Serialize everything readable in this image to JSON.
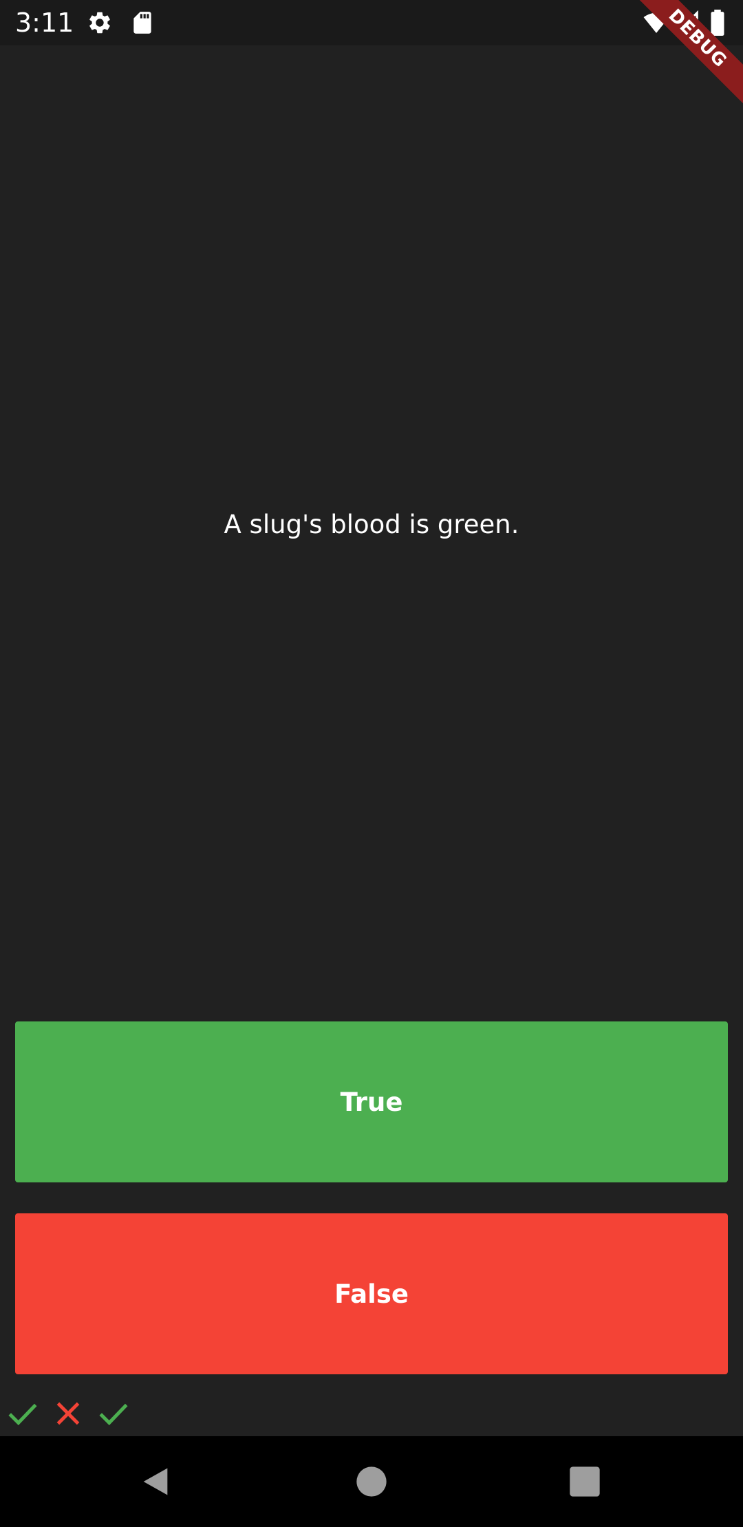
{
  "status_bar": {
    "time": "3:11",
    "icons": [
      "gear-icon",
      "sd-card-icon",
      "wifi-icon",
      "cell-signal-icon",
      "battery-icon"
    ]
  },
  "debug_banner": {
    "label": "DEBUG",
    "color": "#8b1d1d"
  },
  "question": {
    "text": "A slug's blood is green."
  },
  "buttons": {
    "true_label": "True",
    "true_color": "#4caf50",
    "false_label": "False",
    "false_color": "#f44336"
  },
  "score": {
    "results": [
      {
        "icon": "check-icon",
        "correct": true,
        "color": "#4caf50"
      },
      {
        "icon": "close-icon",
        "correct": false,
        "color": "#f44336"
      },
      {
        "icon": "check-icon",
        "correct": true,
        "color": "#4caf50"
      }
    ]
  },
  "nav": {
    "icons": [
      "back-icon",
      "home-icon",
      "recents-icon"
    ]
  },
  "colors": {
    "background": "#212121",
    "status_bar": "#1a1a1a",
    "nav_bar": "#000000",
    "nav_icon": "#9e9e9e"
  }
}
